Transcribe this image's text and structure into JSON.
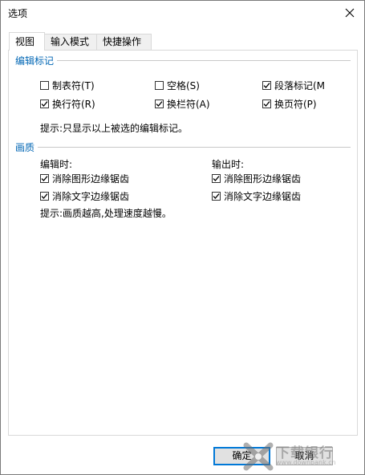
{
  "window": {
    "title": "选项"
  },
  "tabs": [
    {
      "label": "视图",
      "active": true
    },
    {
      "label": "输入模式",
      "active": false
    },
    {
      "label": "快捷操作",
      "active": false
    }
  ],
  "edit_marks": {
    "title": "编辑标记",
    "items": [
      {
        "label": "制表符(T)",
        "checked": false
      },
      {
        "label": "空格(S)",
        "checked": false
      },
      {
        "label": "段落标记(M",
        "checked": true
      },
      {
        "label": "换行符(R)",
        "checked": true
      },
      {
        "label": "换栏符(A)",
        "checked": true
      },
      {
        "label": "换页符(P)",
        "checked": true
      }
    ],
    "hint": "提示:只显示以上被选的编辑标记。"
  },
  "quality": {
    "title": "画质",
    "editing": {
      "heading": "编辑时:",
      "items": [
        {
          "label": "消除图形边缘锯齿",
          "checked": true
        },
        {
          "label": "消除文字边缘锯齿",
          "checked": true
        }
      ]
    },
    "output": {
      "heading": "输出时:",
      "items": [
        {
          "label": "消除图形边缘锯齿",
          "checked": true
        },
        {
          "label": "消除文字边缘锯齿",
          "checked": true
        }
      ]
    },
    "hint": "提示:画质越高,处理速度越慢。"
  },
  "buttons": {
    "ok": "确定",
    "cancel": "取消"
  },
  "watermark": {
    "text": "下载银行",
    "url": "www.downbank.cn"
  },
  "colors": {
    "group_title": "#0066b4",
    "default_button_border": "#0078d7"
  }
}
